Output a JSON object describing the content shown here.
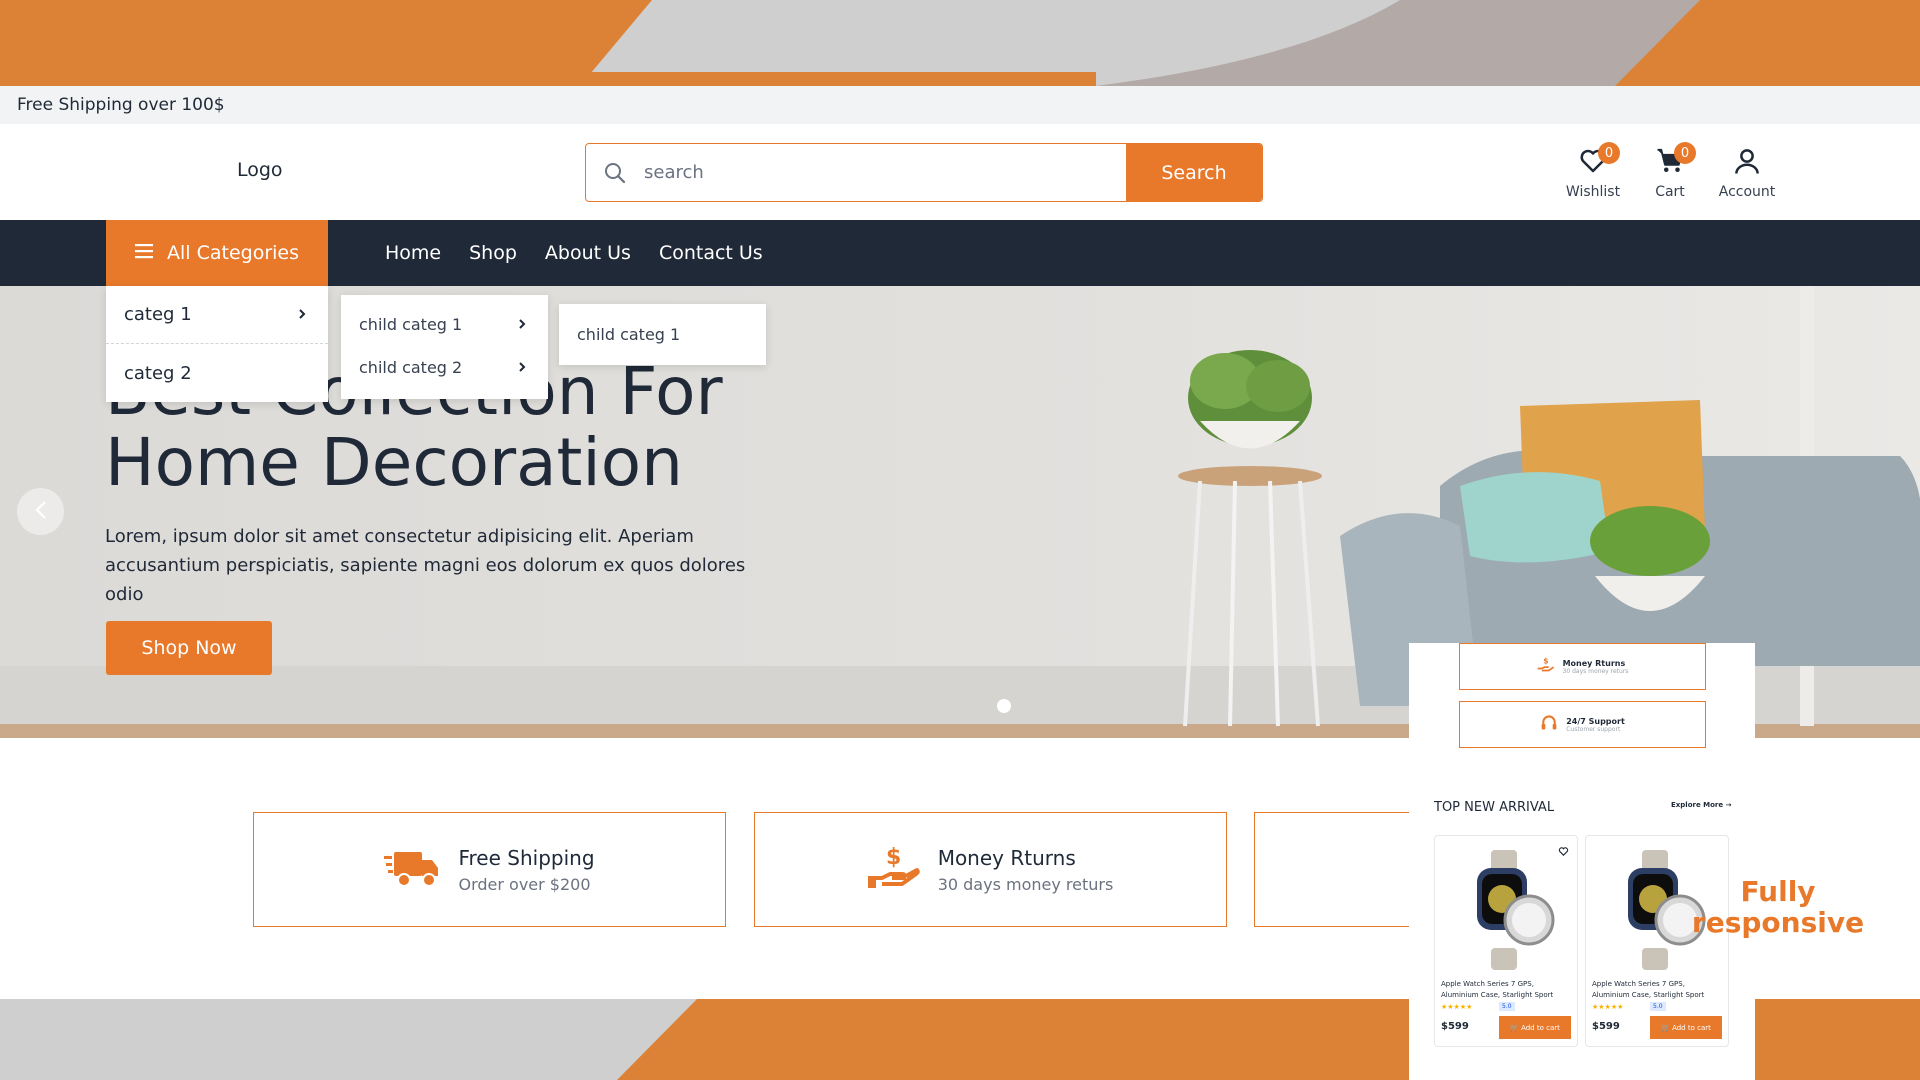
{
  "colors": {
    "accent": "#e8792b",
    "nav_bg": "#1f2937",
    "topbar_bg": "#f2f3f4"
  },
  "topbar": {
    "text": "Free Shipping over 100$"
  },
  "header": {
    "logo": "Logo",
    "search": {
      "placeholder": "search",
      "button": "Search"
    },
    "icons": [
      {
        "name": "heart-icon",
        "label": "Wishlist",
        "count": "0"
      },
      {
        "name": "cart-icon",
        "label": "Cart",
        "count": "0"
      },
      {
        "name": "user-icon",
        "label": "Account"
      }
    ]
  },
  "nav": {
    "all_categories": "All Categories",
    "links": [
      "Home",
      "Shop",
      "About Us",
      "Contact Us"
    ]
  },
  "menu": {
    "categories": [
      "categ 1",
      "categ 2"
    ],
    "children": [
      "child categ 1",
      "child categ 2"
    ],
    "grandchildren": [
      "child categ 1"
    ]
  },
  "hero": {
    "title_line1": "Best Collection For",
    "title_line2": "Home Decoration",
    "text": "Lorem, ipsum dolor sit amet consectetur adipisicing elit. Aperiam accusantium perspiciatis, sapiente magni eos dolorum ex quos dolores odio",
    "cta": "Shop Now"
  },
  "features": [
    {
      "icon": "truck-icon",
      "title": "Free Shipping",
      "subtitle": "Order over $200"
    },
    {
      "icon": "money-hand-icon",
      "title": "Money Rturns",
      "subtitle": "30 days money returs"
    },
    {
      "icon": "headset-icon",
      "title": "",
      "subtitle": ""
    }
  ],
  "mobile": {
    "features": [
      {
        "icon": "money-hand-icon",
        "title": "Money Rturns",
        "subtitle": "30 days money returs"
      },
      {
        "icon": "headset-icon",
        "title": "24/7 Support",
        "subtitle": "Customer support"
      }
    ],
    "section_title": "TOP NEW ARRIVAL",
    "explore": "Explore More",
    "products": [
      {
        "name": "Apple Watch Series 7 GPS, Aluminium Case, Starlight Sport",
        "stars": "★★★★★",
        "rating": "5.0",
        "price": "$599",
        "button": "Add to cart"
      },
      {
        "name": "Apple Watch Series 7 GPS, Aluminium Case, Starlight Sport",
        "stars": "★★★★★",
        "rating": "5.0",
        "price": "$599",
        "button": "Add to cart"
      }
    ]
  },
  "badge": {
    "line1": "Fully",
    "line2": "responsive"
  }
}
